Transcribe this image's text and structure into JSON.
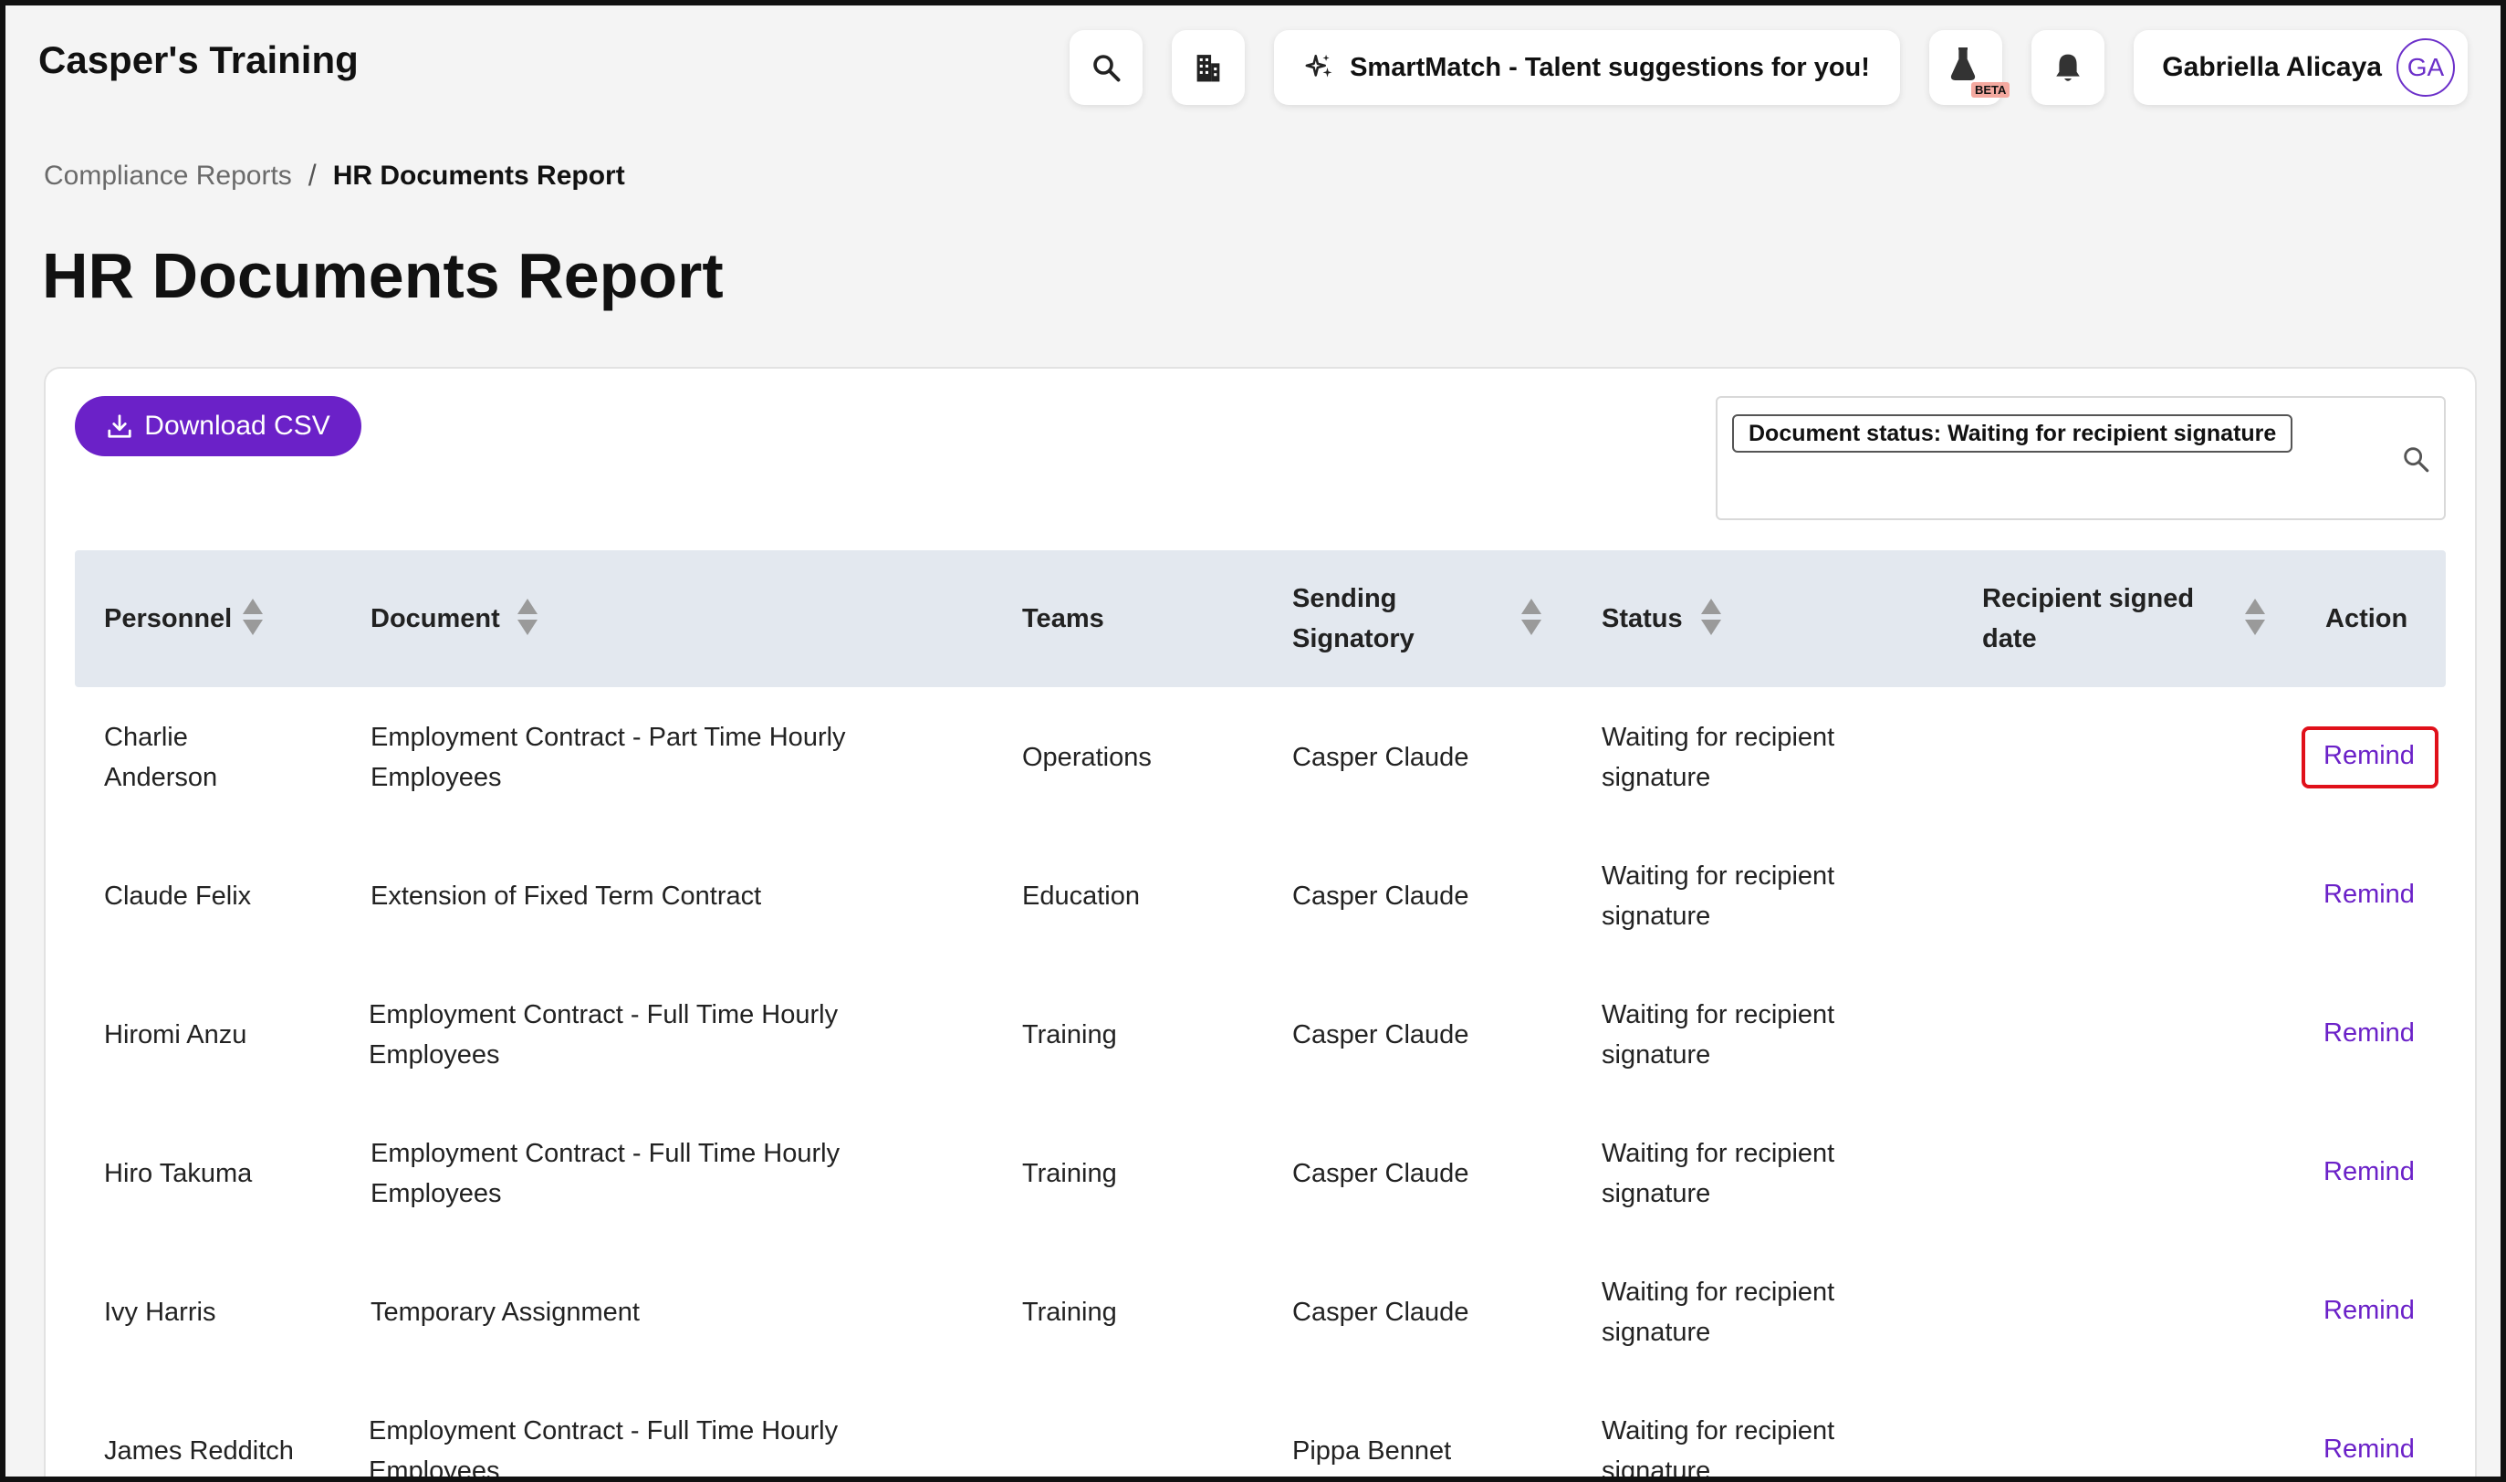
{
  "app": {
    "title": "Casper's Training"
  },
  "topbar": {
    "search_icon": "search-icon",
    "building_icon": "building-icon",
    "smartmatch_label": "SmartMatch - Talent suggestions for you!",
    "beta_label": "BETA",
    "user_name": "Gabriella Alicaya",
    "user_initials": "GA"
  },
  "breadcrumb": {
    "parent": "Compliance Reports",
    "separator": "/",
    "current": "HR Documents Report"
  },
  "page": {
    "title": "HR Documents Report"
  },
  "toolbar": {
    "download_label": "Download CSV"
  },
  "filter": {
    "chip": "Document status: Waiting for recipient signature"
  },
  "table": {
    "headers": {
      "personnel": "Personnel",
      "document": "Document",
      "teams": "Teams",
      "signatory_line1": "Sending",
      "signatory_line2": "Signatory",
      "status": "Status",
      "signed_line1": "Recipient signed",
      "signed_line2": "date",
      "action": "Action"
    },
    "rows": [
      {
        "personnel_1": "Charlie",
        "personnel_2": "Anderson",
        "document_1": "Employment Contract - Part Time Hourly",
        "document_2": "Employees",
        "team": "Operations",
        "signatory": "Casper Claude",
        "status_1": "Waiting for recipient",
        "status_2": "signature",
        "action": "Remind"
      },
      {
        "personnel_1": "Claude Felix",
        "personnel_2": "",
        "document_1": "Extension of Fixed Term Contract",
        "document_2": "",
        "team": "Education",
        "signatory": "Casper Claude",
        "status_1": "Waiting for recipient",
        "status_2": "signature",
        "action": "Remind"
      },
      {
        "personnel_1": "Hiromi Anzu",
        "personnel_2": "",
        "document_1": "Employment Contract - Full Time Hourly",
        "document_2": "Employees",
        "team": "Training",
        "signatory": "Casper Claude",
        "status_1": "Waiting for recipient",
        "status_2": "signature",
        "action": "Remind"
      },
      {
        "personnel_1": "Hiro Takuma",
        "personnel_2": "",
        "document_1": "Employment Contract - Full Time Hourly",
        "document_2": "Employees",
        "team": "Training",
        "signatory": "Casper Claude",
        "status_1": "Waiting for recipient",
        "status_2": "signature",
        "action": "Remind"
      },
      {
        "personnel_1": "Ivy Harris",
        "personnel_2": "",
        "document_1": "Temporary Assignment",
        "document_2": "",
        "team": "Training",
        "signatory": "Casper Claude",
        "status_1": "Waiting for recipient",
        "status_2": "signature",
        "action": "Remind"
      },
      {
        "personnel_1": "James Redditch",
        "personnel_2": "",
        "document_1": "Employment Contract - Full Time Hourly",
        "document_2": "Employees",
        "team": "",
        "signatory": "Pippa Bennet",
        "status_1": "Waiting for recipient",
        "status_2": "signature",
        "action": "Remind"
      }
    ]
  },
  "colors": {
    "accent": "#6b21c8",
    "header_bg": "#e3e8ef",
    "highlight": "#e0101a"
  }
}
